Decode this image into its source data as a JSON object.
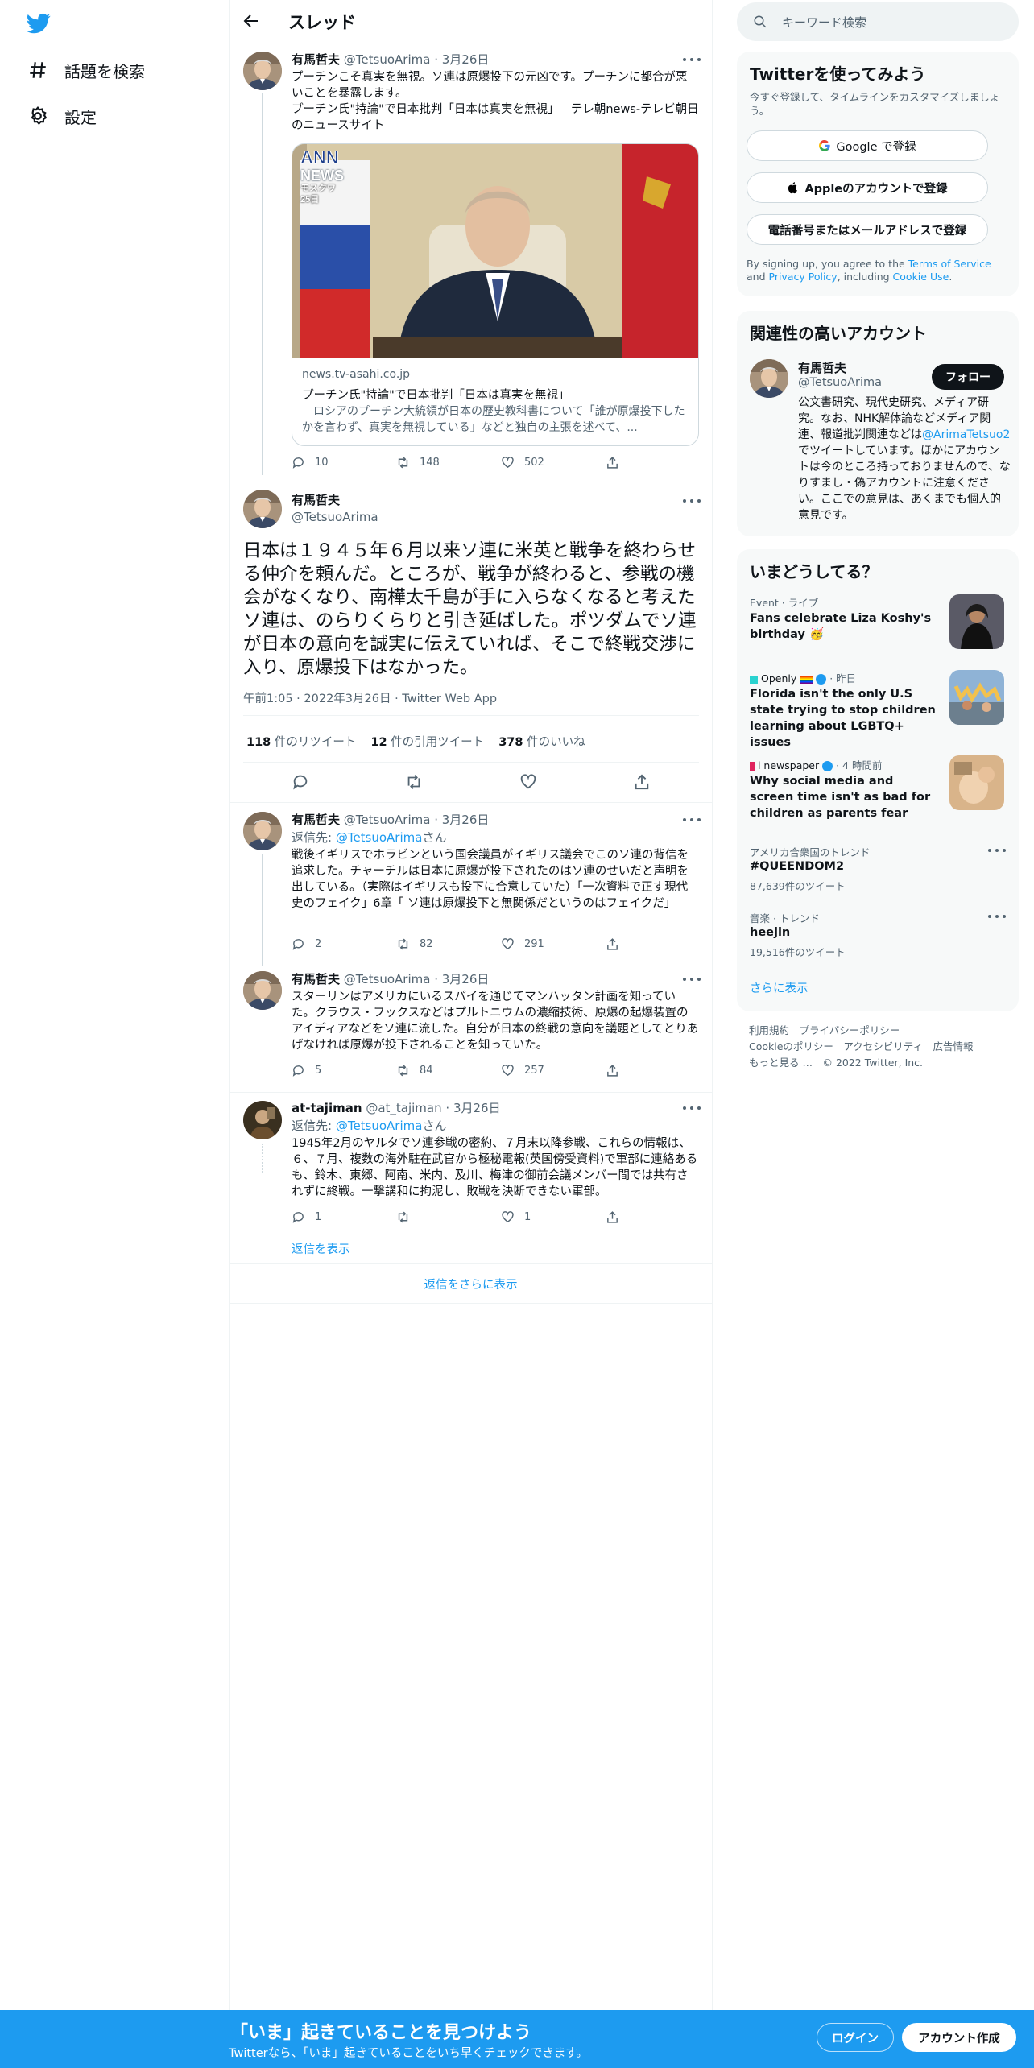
{
  "nav": {
    "explore_label": "話題を検索",
    "settings_label": "設定"
  },
  "header": {
    "title": "スレッド"
  },
  "tweet1": {
    "name": "有馬哲夫",
    "handle": "@TetsuoArima",
    "date": "3月26日",
    "text": "プーチンこそ真実を無視。ソ連は原爆投下の元凶です。プーチンに都合が悪いことを暴露します。",
    "link_text": "プーチン氏\"持論\"で日本批判「日本は真実を無視」｜テレ朝news-テレビ朝日のニュースサイト",
    "card": {
      "badge_ann": "ANN",
      "badge_news": "NEWS",
      "badge_place": "モスクワ",
      "badge_date": "25日",
      "domain": "news.tv-asahi.co.jp",
      "title": "プーチン氏\"持論\"で日本批判「日本は真実を無視」",
      "desc": "ロシアのプーチン大統領が日本の歴史教科書について「誰が原爆投下したかを言わず、真実を無視している」などと独自の主張を述べて、..."
    },
    "replies": "10",
    "retweets": "148",
    "likes": "502"
  },
  "main_tweet": {
    "name": "有馬哲夫",
    "handle": "@TetsuoArima",
    "text": "日本は１９４５年６月以来ソ連に米英と戦争を終わらせる仲介を頼んだ。ところが、戦争が終わると、参戦の機会がなくなり、南樺太千島が手に入らなくなると考えたソ連は、のらりくらりと引き延ばした。ポツダムでソ連が日本の意向を誠実に伝えていれば、そこで終戦交渉に入り、原爆投下はなかった。",
    "meta": "午前1:05 · 2022年3月26日 · Twitter Web App",
    "retweets_count": "118",
    "retweets_label": "件のリツイート",
    "quotes_count": "12",
    "quotes_label": "件の引用ツイート",
    "likes_count": "378",
    "likes_label": "件のいいね"
  },
  "reply1": {
    "name": "有馬哲夫",
    "handle": "@TetsuoArima",
    "date": "3月26日",
    "reply_prefix": "返信先: ",
    "reply_to": "@TetsuoArima",
    "reply_suffix": "さん",
    "text": "戦後イギリスでホラビンという国会議員がイギリス議会でこのソ連の背信を追求した。チャーチルは日本に原爆が投下されたのはソ連のせいだと声明を出している。（実際はイギリスも投下に合意していた）「一次資料で正す現代史のフェイク」6章「 ソ連は原爆投下と無関係だというのはフェイクだ」",
    "replies": "2",
    "retweets": "82",
    "likes": "291"
  },
  "reply2": {
    "name": "有馬哲夫",
    "handle": "@TetsuoArima",
    "date": "3月26日",
    "text": "スターリンはアメリカにいるスパイを通じてマンハッタン計画を知っていた。クラウス・フックスなどはプルトニウムの濃縮技術、原爆の起爆装置のアイディアなどをソ連に流した。自分が日本の終戦の意向を議題としてとりあげなければ原爆が投下されることを知っていた。",
    "replies": "5",
    "retweets": "84",
    "likes": "257"
  },
  "reply3": {
    "name": "at-tajiman",
    "handle": "@at_tajiman",
    "date": "3月26日",
    "reply_prefix": "返信先: ",
    "reply_to": "@TetsuoArima",
    "reply_suffix": "さん",
    "text": "1945年2月のヤルタでソ連参戦の密約、７月末以降参戦、これらの情報は、６、７月、複数の海外駐在武官から極秘電報(英国傍受資料)で軍部に連絡あるも、鈴木、東郷、阿南、米内、及川、梅津の御前会議メンバー間では共有されずに終戦。一撃講和に拘泥し、敗戦を決断できない軍部。",
    "replies": "1",
    "retweets": "",
    "likes": "1",
    "show_replies": "返信を表示"
  },
  "more_replies": "返信をさらに表示",
  "search": {
    "placeholder": "キーワード検索"
  },
  "signup": {
    "title": "Twitterを使ってみよう",
    "subtitle": "今すぐ登録して、タイムラインをカスタマイズしましょう。",
    "google_btn": "Google で登録",
    "apple_btn": "Appleのアカウントで登録",
    "phone_btn": "電話番号またはメールアドレスで登録",
    "terms_pre": "By signing up, you agree to the ",
    "terms_link": "Terms of Service",
    "terms_and": " and ",
    "privacy_link": "Privacy Policy",
    "terms_including": ", including ",
    "cookie_link": "Cookie Use",
    "terms_end": "."
  },
  "related": {
    "title": "関連性の高いアカウント",
    "name": "有馬哲夫",
    "handle": "@TetsuoArima",
    "follow_btn": "フォロー",
    "bio_1": "公文書研究、現代史研究、メディア研究。なお、NHK解体論などメディア関連、報道批判関連などは",
    "bio_link": "@ArimaTetsuo2",
    "bio_2": "でツイートしています。ほかにアカウントは今のところ持っておりませんので、なりすまし・偽アカウントに注意ください。ここでの意見は、あくまでも個人的意見です。"
  },
  "trends": {
    "title": "いまどうしてる？",
    "items": [
      {
        "meta": "Event · ライブ",
        "text": "Fans celebrate Liza Koshy's birthday 🥳"
      },
      {
        "source": "Openly",
        "meta": "· 昨日",
        "text": "Florida isn't the only U.S state trying to stop children learning about LGBTQ+ issues"
      },
      {
        "source": "i newspaper",
        "meta": "· 4 時間前",
        "text": "Why social media and screen time isn't as bad for children as parents fear"
      },
      {
        "meta": "アメリカ合衆国のトレンド",
        "text": "#QUEENDOM2",
        "count": "87,639件のツイート"
      },
      {
        "meta": "音楽 · トレンド",
        "text": "heejin",
        "count": "19,516件のツイート"
      }
    ],
    "show_more": "さらに表示"
  },
  "footer": {
    "line1": "利用規約　プライバシーポリシー",
    "line2": "Cookieのポリシー　アクセシビリティ　広告情報",
    "line3": "もっと見る …　© 2022 Twitter, Inc."
  },
  "bottom_bar": {
    "title": "「いま」起きていることを見つけよう",
    "subtitle": "Twitterなら、「いま」起きていることをいち早くチェックできます。",
    "login_btn": "ログイン",
    "signup_btn": "アカウント作成"
  },
  "colors": {
    "accent": "#1d9bf0",
    "text": "#0f1419",
    "muted": "#536471",
    "panel": "#f7f9f9"
  }
}
